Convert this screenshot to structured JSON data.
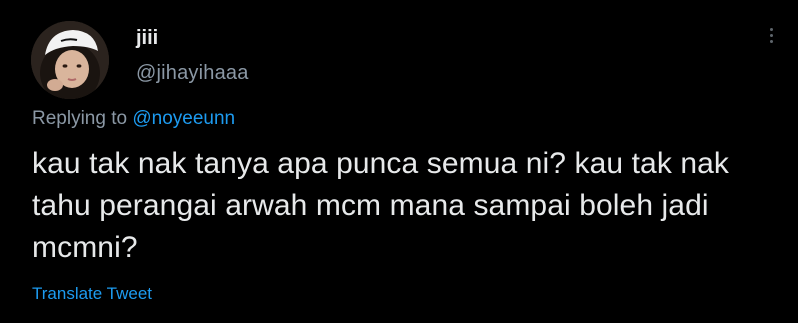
{
  "tweet": {
    "display_name": "jiii",
    "handle": "@jihayihaaa",
    "replying_prefix": "Replying to",
    "replying_to": "@noyeeunn",
    "text": "kau tak nak tanya apa punca semua ni? kau tak nak tahu perangai arwah mcm mana sampai boleh jadi mcmni?",
    "translate_label": "Translate Tweet"
  },
  "icons": {
    "more": "more-vertical-icon",
    "avatar": "profile-avatar"
  },
  "colors": {
    "background": "#000000",
    "text_primary": "#e7e9ea",
    "text_secondary": "#8b98a5",
    "accent": "#1d9bf0"
  }
}
